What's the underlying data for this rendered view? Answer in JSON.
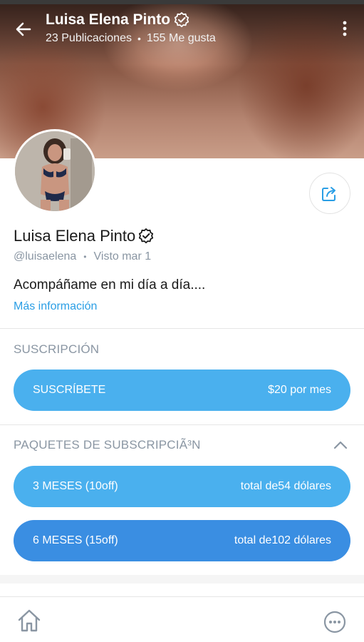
{
  "header": {
    "name": "Luisa Elena Pinto",
    "posts": "23 Publicaciones",
    "likes": "155 Me gusta",
    "separator": "•"
  },
  "profile": {
    "name": "Luisa Elena Pinto",
    "handle": "@luisaelena",
    "separator": "•",
    "last_seen": "Visto mar 1",
    "bio": "Acompáñame en mi día a día....",
    "more_info": "Más información"
  },
  "subscription": {
    "title": "SUSCRIPCIÓN",
    "button_label": "SUSCRÍBETE",
    "button_price": "$20 por mes"
  },
  "bundles": {
    "title": "PAQUETES DE SUBSCRIPCIÃ³N",
    "items": [
      {
        "label": "3 MESES (10off)",
        "price": "total de54 dólares"
      },
      {
        "label": "6 MESES (15off)",
        "price": "total de102 dólares"
      }
    ]
  },
  "colors": {
    "accent": "#4ab0ee",
    "accent_dark": "#3a8ee2",
    "muted": "#8a96a3",
    "link": "#2a9ee5"
  },
  "icons": {
    "back": "arrow-left-icon",
    "more": "more-vertical-icon",
    "verified": "verified-badge-icon",
    "share": "share-icon",
    "collapse": "chevron-up-icon",
    "home": "home-icon",
    "menu": "more-circle-icon"
  }
}
